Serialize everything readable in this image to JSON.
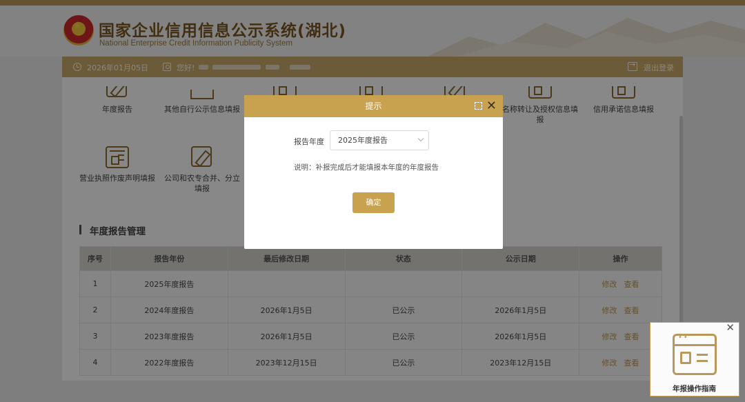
{
  "header": {
    "title_cn": "国家企业信用信息公示系统(湖北)",
    "title_en": "National Enterprise Credit Information Publicity System"
  },
  "navbar": {
    "date": "2026年01月05日",
    "greeting": "您好!",
    "logout": "退出登录"
  },
  "functions": [
    {
      "label": "年度报告"
    },
    {
      "label": "其他自行公示信息填报"
    },
    {
      "label": ""
    },
    {
      "label": ""
    },
    {
      "label": ""
    },
    {
      "label": "名称转让及授权信息填报"
    },
    {
      "label": "信用承诺信息填报"
    },
    {
      "label": "营业执照作废声明填报"
    },
    {
      "label": "公司和农专合并、分立填报"
    }
  ],
  "section": {
    "title": "年度报告管理"
  },
  "table": {
    "headers": [
      "序号",
      "报告年份",
      "最后修改日期",
      "状态",
      "公示日期",
      "操作"
    ],
    "rows": [
      {
        "no": "1",
        "year": "2025年度报告",
        "modified": "",
        "status": "",
        "published": "",
        "edit": "修改",
        "view": "查看"
      },
      {
        "no": "2",
        "year": "2024年度报告",
        "modified": "2026年1月5日",
        "status": "已公示",
        "published": "2026年1月5日",
        "edit": "修改",
        "view": "查看"
      },
      {
        "no": "3",
        "year": "2023年度报告",
        "modified": "2026年1月5日",
        "status": "已公示",
        "published": "2026年1月5日",
        "edit": "修改",
        "view": "查看"
      },
      {
        "no": "4",
        "year": "2022年度报告",
        "modified": "2023年12月15日",
        "status": "已公示",
        "published": "2023年12月15日",
        "edit": "修改",
        "view": "查看"
      }
    ]
  },
  "modal": {
    "title": "提示",
    "field_label": "报告年度",
    "selected": "2025年度报告",
    "note": "说明：补报完成后才能填报本年度的年度报告",
    "confirm": "确定"
  },
  "guide": {
    "label": "年报操作指南"
  },
  "colors": {
    "accent": "#c9a24f",
    "brand_text": "#7b5720"
  }
}
